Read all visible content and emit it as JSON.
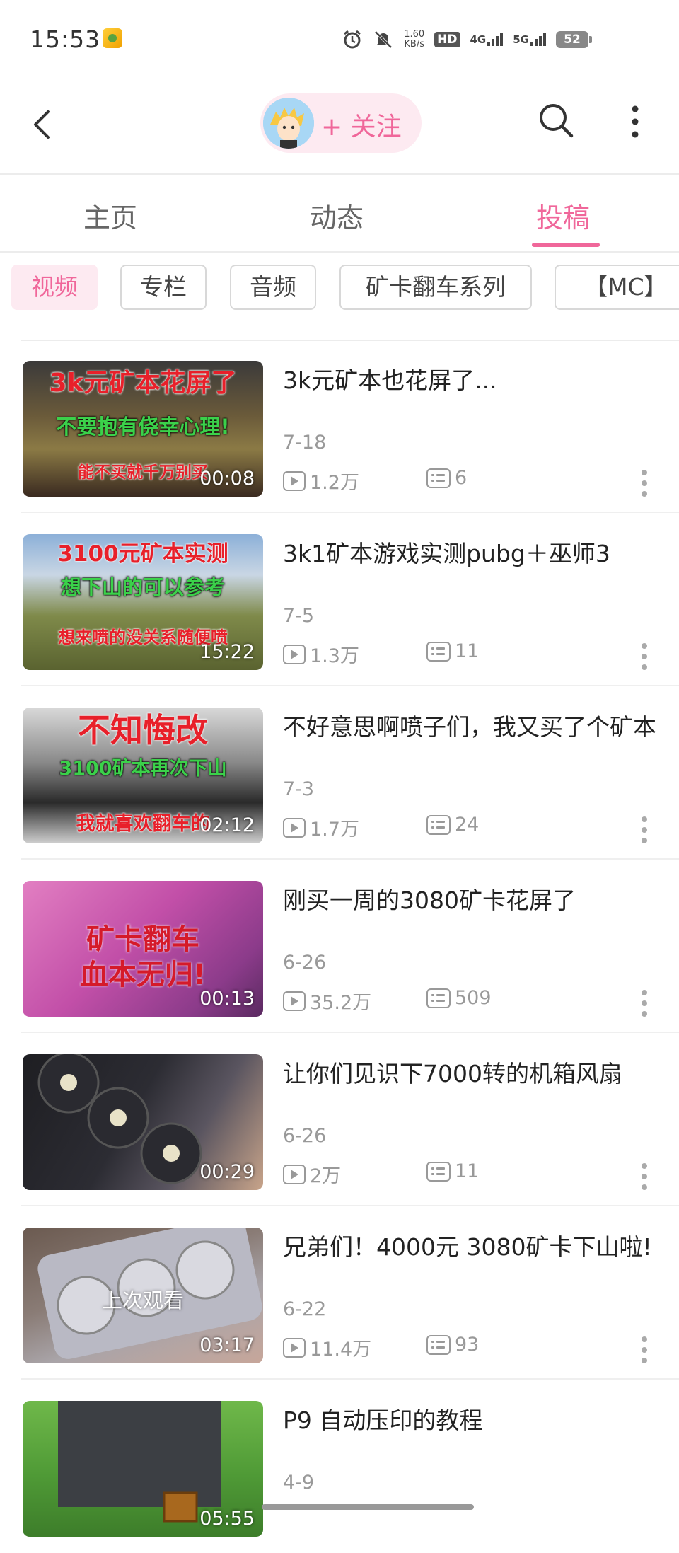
{
  "status_bar": {
    "time": "15:53",
    "net_speed_value": "1.60",
    "net_speed_unit": "KB/s",
    "hd_label": "HD",
    "sim1_label": "4G",
    "sim2_label": "5G",
    "battery": "52",
    "icons": [
      "alarm-icon",
      "mute-icon",
      "signal-icon",
      "battery-icon"
    ]
  },
  "header": {
    "back_icon": "chevron-left-icon",
    "follow_label": "+ 关注",
    "search_icon": "search-icon",
    "more_icon": "more-vertical-icon",
    "accent_color": "#f0679a"
  },
  "tabs": [
    {
      "label": "主页",
      "active": false
    },
    {
      "label": "动态",
      "active": false
    },
    {
      "label": "投稿",
      "active": true
    }
  ],
  "chips": [
    {
      "label": "视频",
      "active": true
    },
    {
      "label": "专栏",
      "active": false
    },
    {
      "label": "音频",
      "active": false
    },
    {
      "label": "矿卡翻车系列",
      "active": false
    },
    {
      "label": "【MC】",
      "active": false
    }
  ],
  "videos": [
    {
      "title": "3k元矿本也花屏了...",
      "date": "7-18",
      "views": "1.2万",
      "danmaku": "6",
      "duration": "00:08",
      "overlay": [
        "3k元矿本花屏了",
        "不要抱有侥幸心理!",
        "能不买就千万别买"
      ]
    },
    {
      "title": "3k1矿本游戏实测pubg＋巫师3",
      "date": "7-5",
      "views": "1.3万",
      "danmaku": "11",
      "duration": "15:22",
      "overlay": [
        "3100元矿本实测",
        "想下山的可以参考",
        "想来喷的没关系随便喷"
      ]
    },
    {
      "title": "不好意思啊喷子们，我又买了个矿本",
      "date": "7-3",
      "views": "1.7万",
      "danmaku": "24",
      "duration": "02:12",
      "overlay": [
        "不知悔改",
        "3100矿本再次下山",
        "我就喜欢翻车的"
      ]
    },
    {
      "title": "刚买一周的3080矿卡花屏了",
      "date": "6-26",
      "views": "35.2万",
      "danmaku": "509",
      "duration": "00:13",
      "overlay": [
        "矿卡翻车",
        "血本无归!"
      ]
    },
    {
      "title": "让你们见识下7000转的机箱风扇",
      "date": "6-26",
      "views": "2万",
      "danmaku": "11",
      "duration": "00:29",
      "overlay": []
    },
    {
      "title": "兄弟们！4000元 3080矿卡下山啦!",
      "date": "6-22",
      "views": "11.4万",
      "danmaku": "93",
      "duration": "03:17",
      "watched_label": "上次观看",
      "overlay": []
    },
    {
      "title": "P9 自动压印的教程",
      "date": "4-9",
      "views": "",
      "danmaku": "",
      "duration": "05:55",
      "overlay": []
    }
  ]
}
